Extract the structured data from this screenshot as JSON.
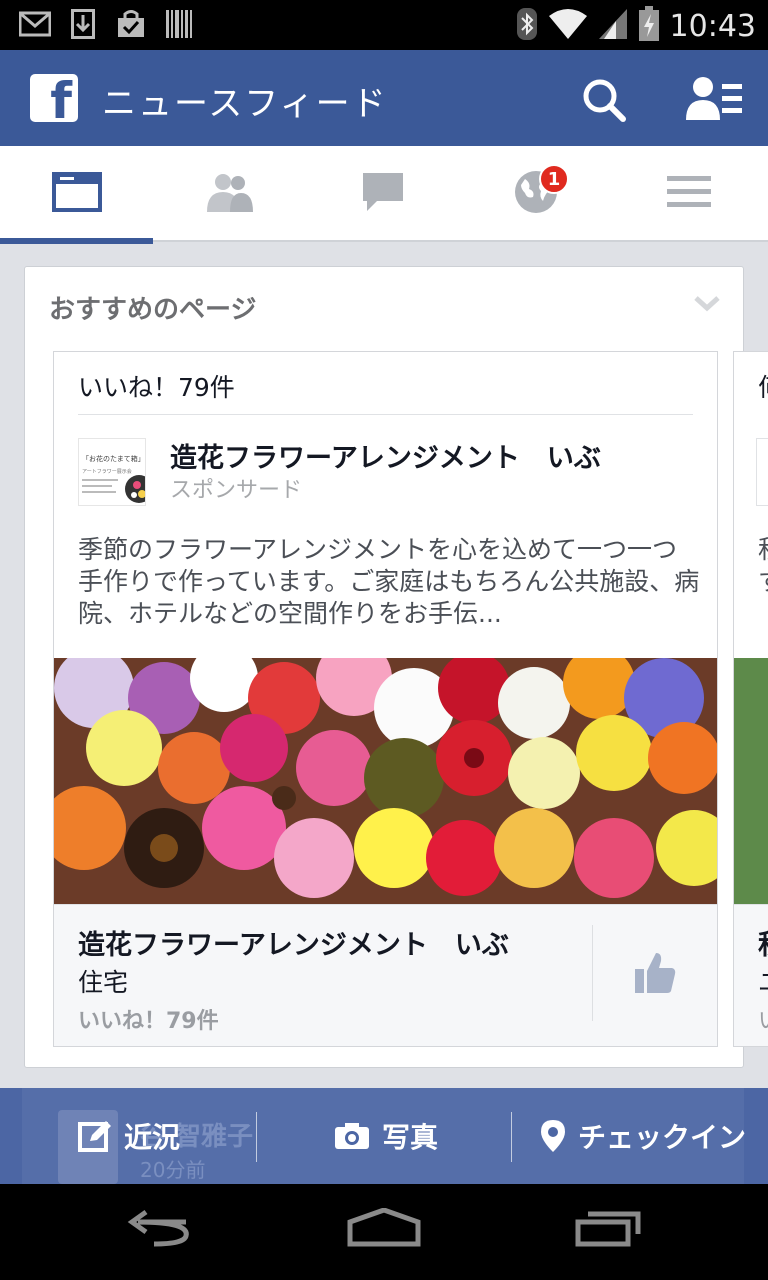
{
  "status_bar": {
    "time": "10:43",
    "left_icons": [
      "gmail-icon",
      "download-icon",
      "shopping-bag-icon",
      "barcode-icon"
    ],
    "right_icons": [
      "bluetooth-icon",
      "wifi-icon",
      "signal-icon",
      "battery-charging-icon"
    ]
  },
  "header": {
    "logo": "f",
    "title": "ニュースフィード",
    "icons": [
      "search-icon",
      "friend-requests-icon"
    ]
  },
  "tabs": {
    "items": [
      "news-feed-icon",
      "friends-icon",
      "messages-icon",
      "notifications-globe-icon",
      "menu-icon"
    ],
    "active_index": 0,
    "notification_badge": "1"
  },
  "suggested": {
    "heading": "おすすめのページ",
    "page": {
      "likes_top": "いいね！79件",
      "name": "造花フラワーアレンジメント　いぶ",
      "sponsored": "スポンサード",
      "description": "季節のフラワーアレンジメントを心を込めて一つ一つ手作りで作っています。ご家庭はもちろん公共施設、病院、ホテルなどの空間作りをお手伝...",
      "footer_name": "造花フラワーアレンジメント　いぶ",
      "footer_category": "住宅",
      "footer_likes": "いいね！79件"
    },
    "peek": {
      "top": "何",
      "line1": "秋",
      "line2": "す",
      "f1": "秋",
      "f2": "ユ",
      "f3": "い"
    }
  },
  "thumb_text": {
    "l1": "「お花のたまて箱」",
    "l2": "アートフラワー展示会"
  },
  "composer": {
    "status_label": "近況",
    "photo_label": "写真",
    "checkin_label": "チェックイン",
    "behind_name": "谷 智雅子",
    "behind_time": "20分前"
  },
  "colors": {
    "brand": "#3b5998",
    "badge": "#e02a1f",
    "composer": "#4c66a4"
  }
}
